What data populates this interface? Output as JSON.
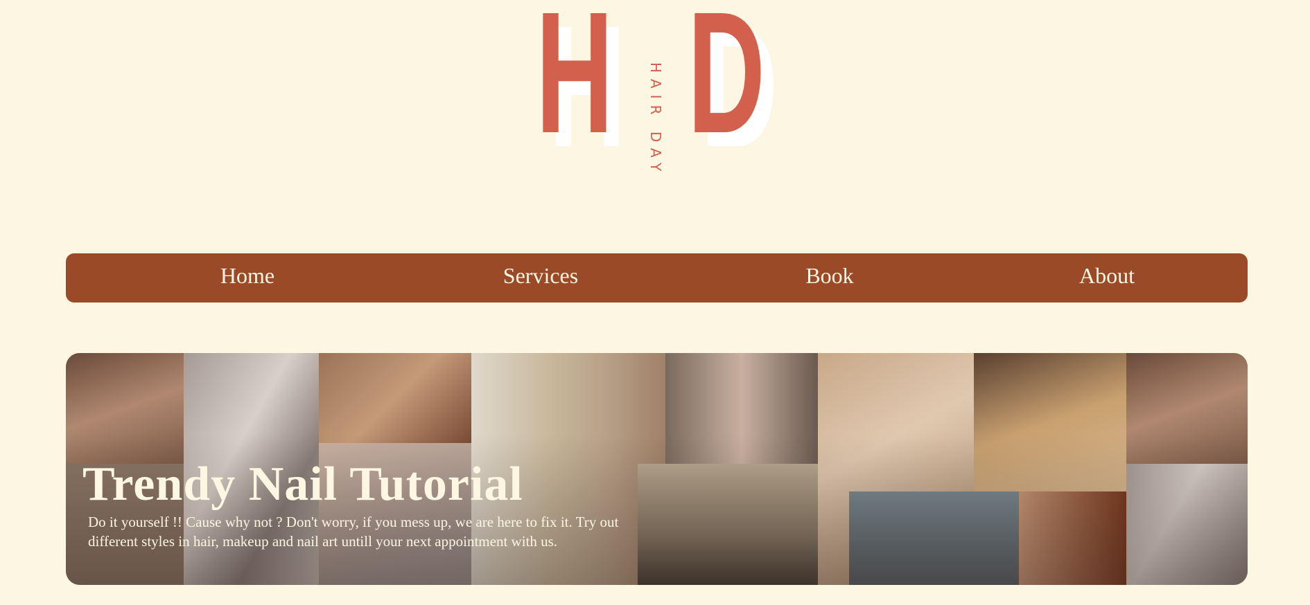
{
  "logo": {
    "letter1": "H",
    "letter2": "D",
    "text": "HAIR DAY",
    "color": "#d3604d"
  },
  "nav": {
    "items": [
      {
        "label": "Home"
      },
      {
        "label": "Services"
      },
      {
        "label": "Book"
      },
      {
        "label": "About"
      }
    ],
    "background": "#9b4a28"
  },
  "hero": {
    "title": "Trendy Nail Tutorial",
    "description": "Do it yourself !! Cause why not ? Don't worry, if you mess up, we are here to fix it. Try out different styles in hair, makeup and nail art untill your next appointment with us."
  }
}
